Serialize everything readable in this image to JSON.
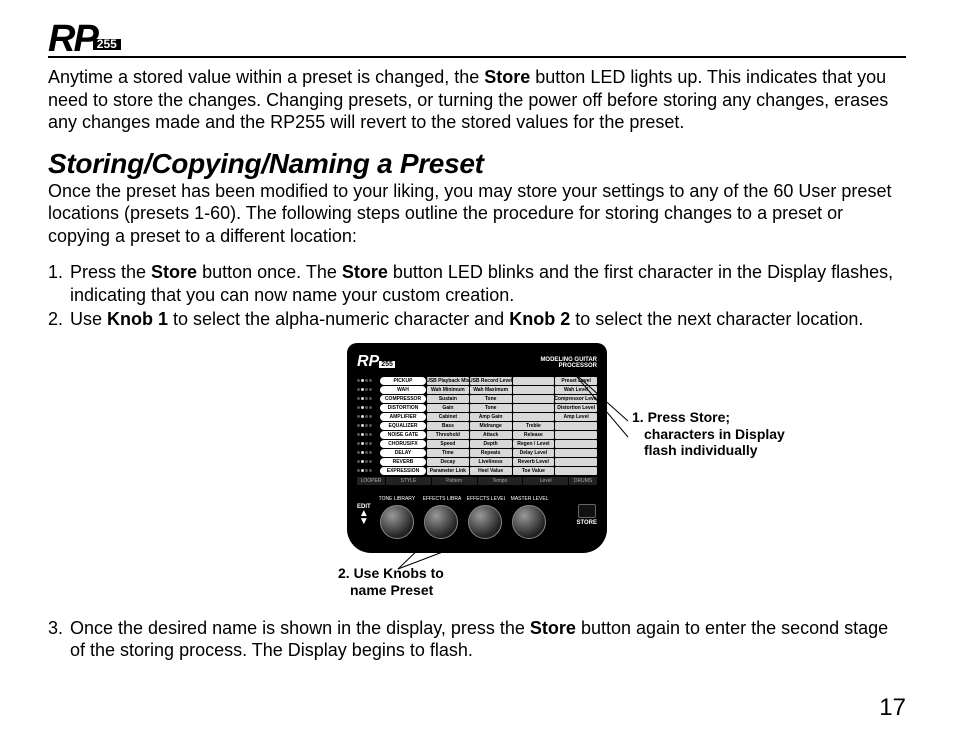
{
  "header": {
    "logo_main": "RP",
    "logo_num": "255"
  },
  "intro": {
    "pre1": "Anytime a stored value within a preset is changed, the ",
    "b1": "Store",
    "post1": " button LED lights up.  This indicates that you need to store the changes.  Changing presets, or turning the power off before storing any changes, erases any changes made and the RP255 will revert to the stored values for the preset."
  },
  "section_title": "Storing/Copying/Naming a Preset",
  "section_intro": "Once the preset has been modified to your liking, you may store your settings to any of the 60 User preset locations (presets 1-60).  The following steps outline the procedure for storing changes to a preset or copying a preset to a different location:",
  "step1": {
    "pre1": "Press the ",
    "b1": "Store",
    "mid1": " button once.  The ",
    "b2": "Store",
    "post1": " button LED blinks and the first character in the Display flashes, indicating that you can now name your custom creation."
  },
  "step2": {
    "pre1": "Use ",
    "b1": "Knob 1",
    "mid1": " to select the alpha-numeric character and ",
    "b2": "Knob 2",
    "post1": " to select the next character location."
  },
  "step3": {
    "pre1": "Once the desired name is shown in the display, press the ",
    "b1": "Store",
    "post1": " button again to enter the second stage of the storing process.  The Display begins to flash."
  },
  "device": {
    "logo_main": "RP",
    "logo_num": "255",
    "title_line1": "MODELING GUITAR",
    "title_line2": "PROCESSOR",
    "rows": [
      {
        "tag": "PICKUP",
        "c1": "USB Playback Mix",
        "c2": "USB Record Level",
        "c3": "",
        "c4": "Preset Level"
      },
      {
        "tag": "WAH",
        "c1": "Wah Minimum",
        "c2": "Wah Maximum",
        "c3": "",
        "c4": "Wah Level"
      },
      {
        "tag": "COMPRESSOR",
        "c1": "Sustain",
        "c2": "Tone",
        "c3": "",
        "c4": "Compressor Level"
      },
      {
        "tag": "DISTORTION",
        "c1": "Gain",
        "c2": "Tone",
        "c3": "",
        "c4": "Distortion Level"
      },
      {
        "tag": "AMPLIFIER",
        "c1": "Cabinet",
        "c2": "Amp Gain",
        "c3": "",
        "c4": "Amp Level"
      },
      {
        "tag": "EQUALIZER",
        "c1": "Bass",
        "c2": "Midrange",
        "c3": "Treble",
        "c4": ""
      },
      {
        "tag": "NOISE GATE",
        "c1": "Threshold",
        "c2": "Attack",
        "c3": "Release",
        "c4": ""
      },
      {
        "tag": "CHORUS/FX",
        "c1": "Speed",
        "c2": "Depth",
        "c3": "Regen / Level",
        "c4": ""
      },
      {
        "tag": "DELAY",
        "c1": "Time",
        "c2": "Repeats",
        "c3": "Delay Level",
        "c4": ""
      },
      {
        "tag": "REVERB",
        "c1": "Decay",
        "c2": "Liveliness",
        "c3": "Reverb Level",
        "c4": ""
      },
      {
        "tag": "EXPRESSION",
        "c1": "Parameter Link",
        "c2": "Heel Value",
        "c3": "Toe Value",
        "c4": ""
      }
    ],
    "bottom": {
      "c0": "LOOPER",
      "c1": "STYLE",
      "c2": "Pattern",
      "c3": "Tempo",
      "c4": "Level",
      "c5": "DRUMS"
    },
    "edit_label": "EDIT",
    "knobs": [
      "TONE LIBRARY",
      "EFFECTS LIBRARY",
      "EFFECTS LEVEL",
      "MASTER LEVEL"
    ],
    "store_label": "STORE"
  },
  "callout1": {
    "l1": "1. Press Store;",
    "l2": "characters in Display",
    "l3": "flash individually"
  },
  "callout2": {
    "l1": "2. Use Knobs to",
    "l2": "name Preset"
  },
  "page_number": "17"
}
